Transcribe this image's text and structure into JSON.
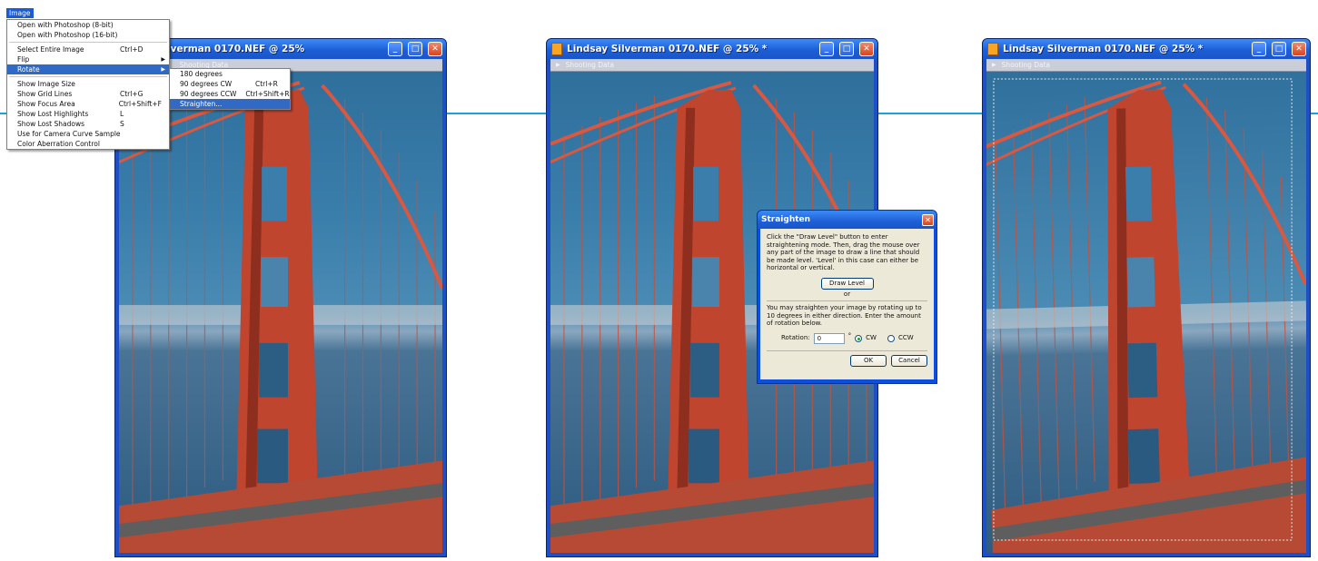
{
  "menu": {
    "title": "Image",
    "items": [
      {
        "label": "Open with Photoshop (8-bit)",
        "shortcut": "",
        "submenu": false
      },
      {
        "label": "Open with Photoshop (16-bit)",
        "shortcut": "",
        "submenu": false
      },
      {
        "label": "Select Entire Image",
        "shortcut": "Ctrl+D",
        "submenu": false
      },
      {
        "label": "Flip",
        "shortcut": "",
        "submenu": true
      },
      {
        "label": "Rotate",
        "shortcut": "",
        "submenu": true,
        "selected": true
      },
      {
        "label": "Show Image Size",
        "shortcut": "",
        "submenu": false
      },
      {
        "label": "Show Grid Lines",
        "shortcut": "Ctrl+G",
        "submenu": false
      },
      {
        "label": "Show Focus Area",
        "shortcut": "Ctrl+Shift+F",
        "submenu": false
      },
      {
        "label": "Show Lost Highlights",
        "shortcut": "L",
        "submenu": false
      },
      {
        "label": "Show Lost Shadows",
        "shortcut": "S",
        "submenu": false
      },
      {
        "label": "Use for Camera Curve Sample",
        "shortcut": "",
        "submenu": false
      },
      {
        "label": "Color Aberration Control",
        "shortcut": "",
        "submenu": false
      }
    ],
    "rotate_submenu": [
      {
        "label": "180 degrees",
        "shortcut": ""
      },
      {
        "label": "90 degrees CW",
        "shortcut": "Ctrl+R"
      },
      {
        "label": "90 degrees CCW",
        "shortcut": "Ctrl+Shift+R"
      },
      {
        "label": "Straighten...",
        "shortcut": "",
        "selected": true
      }
    ]
  },
  "windows": [
    {
      "title": "Lindsay Silverman  0170.NEF @ 25%",
      "visible_title": "lverman  0170.NEF @ 25%",
      "info": "Shooting Data"
    },
    {
      "title": "Lindsay Silverman  0170.NEF @ 25% *",
      "info": "Shooting Data"
    },
    {
      "title": "Lindsay Silverman  0170.NEF @ 25% *",
      "info": "Shooting Data"
    }
  ],
  "dialog": {
    "title": "Straighten",
    "text1": "Click the \"Draw Level\" button to enter straightening mode.  Then, drag the mouse over any part of the image to draw a line that should be made level. 'Level' in this case can either be horizontal or vertical.",
    "draw_level": "Draw Level",
    "or": "or",
    "text2": "You may straighten your image by rotating up to 10 degrees in either direction.  Enter the amount of rotation below.",
    "rotation_label": "Rotation:",
    "rotation_value": "0",
    "degree": "°",
    "cw": "CW",
    "ccw": "CCW",
    "ok": "OK",
    "cancel": "Cancel"
  },
  "colors": {
    "titlebar": "#1d5fd6",
    "accent_line": "#1aa0dc",
    "bridge": "#c0452f",
    "menu_highlight": "#316ac5"
  }
}
